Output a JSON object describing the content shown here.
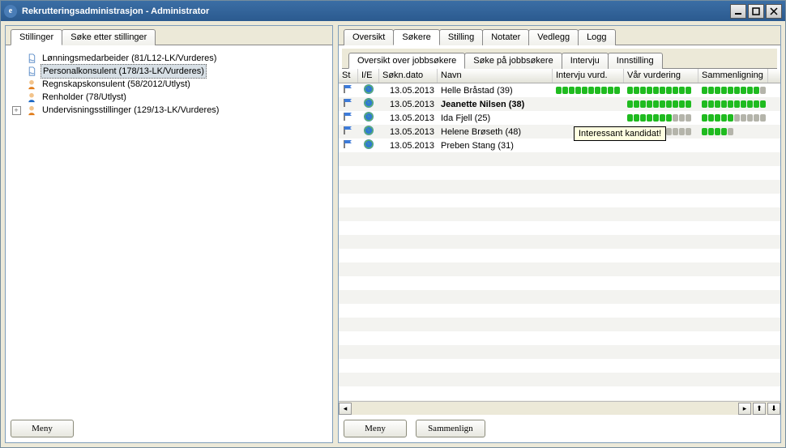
{
  "window": {
    "title": "Rekrutteringsadministrasjon - Administrator"
  },
  "left_tabs": {
    "items": [
      "Stillinger",
      "Søke etter stillinger"
    ],
    "active": 0
  },
  "tree": {
    "items": [
      {
        "icon": "doc",
        "label": "Lønningsmedarbeider (81/L12-LK/Vurderes)",
        "level": 1,
        "selected": false
      },
      {
        "icon": "doc",
        "label": "Personalkonsulent (178/13-LK/Vurderes)",
        "level": 1,
        "selected": true
      },
      {
        "icon": "person-orange",
        "label": "Regnskapskonsulent (58/2012/Utlyst)",
        "level": 1
      },
      {
        "icon": "person-blue",
        "label": "Renholder (78/Utlyst)",
        "level": 1
      },
      {
        "icon": "person-orange",
        "label": "Undervisningsstillinger (129/13-LK/Vurderes)",
        "level": 1,
        "expandable": true
      }
    ]
  },
  "left_footer": {
    "menu": "Meny"
  },
  "right_tabs": {
    "items": [
      "Oversikt",
      "Søkere",
      "Stilling",
      "Notater",
      "Vedlegg",
      "Logg"
    ],
    "active": 1
  },
  "right_subtabs": {
    "items": [
      "Oversikt over jobbsøkere",
      "Søke på jobbsøkere",
      "Intervju",
      "Innstilling"
    ],
    "active": 0
  },
  "grid": {
    "columns": [
      "St",
      "I/E",
      "Søkn.dato",
      "Navn",
      "Intervju vurd.",
      "Vår vurdering",
      "Sammenligning"
    ],
    "rows": [
      {
        "date": "13.05.2013",
        "name": "Helle Bråstad (39)",
        "iv": 10,
        "vv": 10,
        "sl": 9,
        "sltot": 10,
        "bold": false
      },
      {
        "date": "13.05.2013",
        "name": "Jeanette Nilsen (38)",
        "iv": 0,
        "vv": 10,
        "sl": 10,
        "sltot": 10,
        "bold": true
      },
      {
        "date": "13.05.2013",
        "name": "Ida Fjell (25)",
        "iv": 0,
        "vv": 7,
        "sl": 5,
        "sltot": 10,
        "bold": false
      },
      {
        "date": "13.05.2013",
        "name": "Helene Brøseth (48)",
        "iv": 0,
        "vv": 5,
        "sl": 4,
        "sltot": 5,
        "bold": false,
        "tooltip": "Interessant kandidat!"
      },
      {
        "date": "13.05.2013",
        "name": "Preben Stang (31)",
        "iv": 0,
        "vv": 0,
        "sl": 0,
        "sltot": 0,
        "bold": false
      }
    ]
  },
  "right_footer": {
    "menu": "Meny",
    "compare": "Sammenlign"
  }
}
